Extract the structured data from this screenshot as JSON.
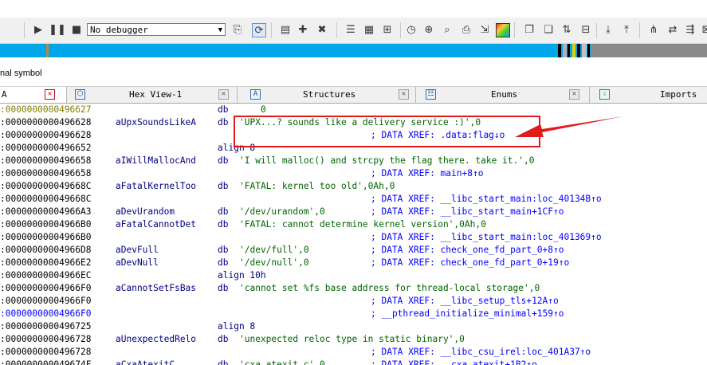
{
  "toolbar": {
    "debugger_select": "No debugger"
  },
  "status": {
    "symbol_line": "nal symbol"
  },
  "tabs": [
    {
      "label": "A",
      "active": true
    },
    {
      "label": "Hex View-1"
    },
    {
      "label": "Structures"
    },
    {
      "label": "Enums"
    },
    {
      "label": "Imports"
    }
  ],
  "listing": [
    {
      "addr": ":0000000000496627",
      "name": "",
      "op": "db",
      "arg": "    0",
      "cmt": "",
      "addr_style": "olive"
    },
    {
      "addr": ":0000000000496628",
      "name": "aUpxSoundsLikeA",
      "op": "db",
      "arg": "'UPX...? sounds like a delivery service :)',0",
      "cmt": ""
    },
    {
      "addr": ":0000000000496628",
      "name": "",
      "op": "",
      "arg": "",
      "cmt": "; DATA XREF: .data:flag↓o"
    },
    {
      "addr": ":0000000000496652",
      "name": "",
      "op": "align 8",
      "arg": "",
      "cmt": ""
    },
    {
      "addr": ":0000000000496658",
      "name": "aIWillMallocAnd",
      "op": "db",
      "arg": "'I will malloc() and strcpy the flag there. take it.',0",
      "cmt": ""
    },
    {
      "addr": ":0000000000496658",
      "name": "",
      "op": "",
      "arg": "",
      "cmt": "; DATA XREF: main+8↑o"
    },
    {
      "addr": ":000000000049668C",
      "name": "aFatalKernelToo",
      "op": "db",
      "arg": "'FATAL: kernel too old',0Ah,0",
      "cmt": ""
    },
    {
      "addr": ":000000000049668C",
      "name": "",
      "op": "",
      "arg": "",
      "cmt": "; DATA XREF: __libc_start_main:loc_40134B↑o"
    },
    {
      "addr": ":00000000004966A3",
      "name": "aDevUrandom",
      "op": "db",
      "arg": "'/dev/urandom',0",
      "cmt": "; DATA XREF: __libc_start_main+1CF↑o"
    },
    {
      "addr": ":00000000004966B0",
      "name": "aFatalCannotDet",
      "op": "db",
      "arg": "'FATAL: cannot determine kernel version',0Ah,0",
      "cmt": ""
    },
    {
      "addr": ":00000000004966B0",
      "name": "",
      "op": "",
      "arg": "",
      "cmt": "; DATA XREF: __libc_start_main:loc_401369↑o"
    },
    {
      "addr": ":00000000004966D8",
      "name": "aDevFull",
      "op": "db",
      "arg": "'/dev/full',0",
      "cmt": "; DATA XREF: check_one_fd_part_0+8↑o"
    },
    {
      "addr": ":00000000004966E2",
      "name": "aDevNull",
      "op": "db",
      "arg": "'/dev/null',0",
      "cmt": "; DATA XREF: check_one_fd_part_0+19↑o"
    },
    {
      "addr": ":00000000004966EC",
      "name": "",
      "op": "align 10h",
      "arg": "",
      "cmt": ""
    },
    {
      "addr": ":00000000004966F0",
      "name": "aCannotSetFsBas",
      "op": "db",
      "arg": "'cannot set %fs base address for thread-local storage',0",
      "cmt": ""
    },
    {
      "addr": ":00000000004966F0",
      "name": "",
      "op": "",
      "arg": "",
      "cmt": "; DATA XREF: __libc_setup_tls+12A↑o"
    },
    {
      "addr": ":00000000004966F0",
      "name": "",
      "op": "",
      "arg": "",
      "cmt": "; __pthread_initialize_minimal+159↑o",
      "addr_style": "blue"
    },
    {
      "addr": ":0000000000496725",
      "name": "",
      "op": "align 8",
      "arg": "",
      "cmt": ""
    },
    {
      "addr": ":0000000000496728",
      "name": "aUnexpectedRelo",
      "op": "db",
      "arg": "'unexpected reloc type in static binary',0",
      "cmt": ""
    },
    {
      "addr": ":0000000000496728",
      "name": "",
      "op": "",
      "arg": "",
      "cmt": "; DATA XREF: __libc_csu_irel:loc_401A37↑o"
    },
    {
      "addr": ":000000000049674F",
      "name": "aCxaAtexitC",
      "op": "db",
      "arg": "'cxa_atexit.c',0",
      "cmt": "; DATA XREF: __cxa_atexit+1B2↑o"
    }
  ],
  "colors": {
    "navband": "#00a6e8",
    "highlight": "#e21a1a"
  }
}
